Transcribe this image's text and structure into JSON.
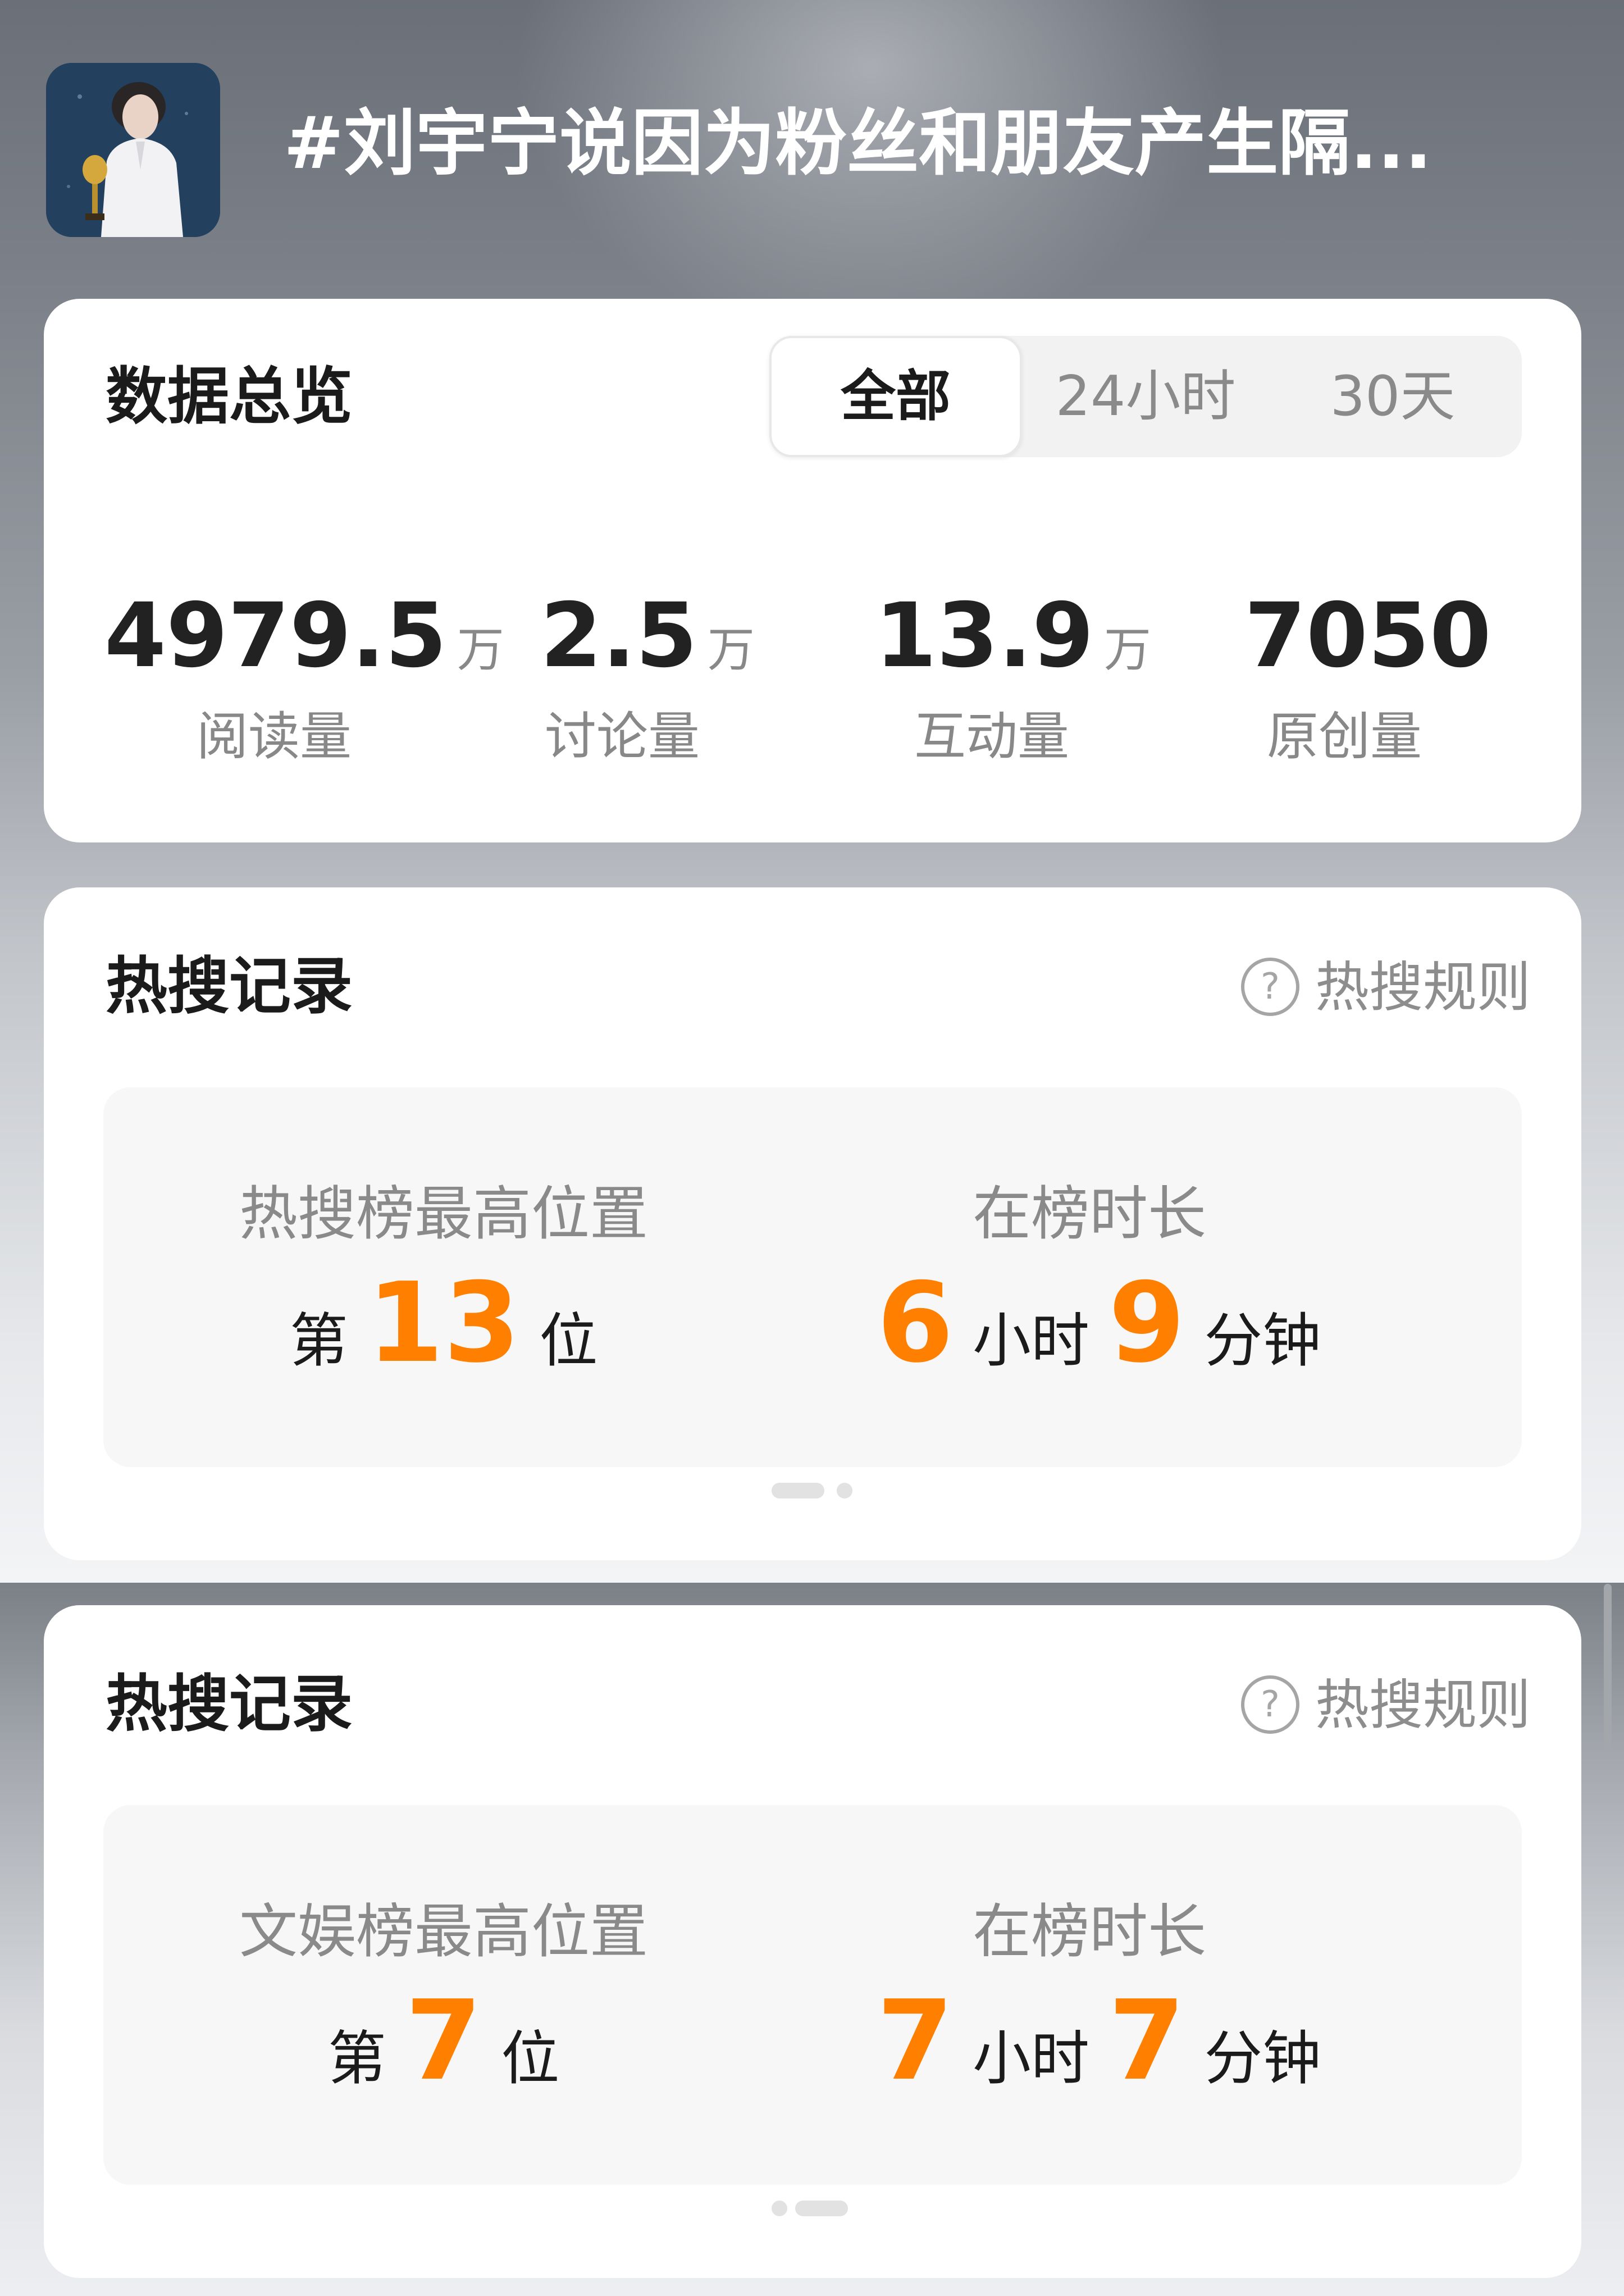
{
  "topic": {
    "title": "#刘宇宁说因为粉丝和朋友产生隔..."
  },
  "overview": {
    "title": "数据总览",
    "tabs": [
      {
        "label": "全部",
        "active": true
      },
      {
        "label": "24小时",
        "active": false
      },
      {
        "label": "30天",
        "active": false
      }
    ],
    "stats": [
      {
        "value": "4979.5",
        "unit": "万",
        "label": "阅读量"
      },
      {
        "value": "2.5",
        "unit": "万",
        "label": "讨论量"
      },
      {
        "value": "13.9",
        "unit": "万",
        "label": "互动量"
      },
      {
        "value": "7050",
        "unit": "",
        "label": "原创量"
      }
    ]
  },
  "hot_cards": [
    {
      "title": "热搜记录",
      "rules_label": "热搜规则",
      "rank_label": "热搜榜最高位置",
      "rank_prefix": "第",
      "rank_value": "13",
      "rank_suffix": "位",
      "duration_label": "在榜时长",
      "hours": "6",
      "hours_unit": "小时",
      "minutes": "9",
      "minutes_unit": "分钟",
      "active_page": 1,
      "total_pages": 2
    },
    {
      "title": "热搜记录",
      "rules_label": "热搜规则",
      "rank_label": "文娱榜最高位置",
      "rank_prefix": "第",
      "rank_value": "7",
      "rank_suffix": "位",
      "duration_label": "在榜时长",
      "hours": "7",
      "hours_unit": "小时",
      "minutes": "7",
      "minutes_unit": "分钟",
      "active_page": 2,
      "total_pages": 2
    }
  ],
  "colors": {
    "accent": "#ff7f00",
    "card_bg": "#ffffff",
    "inner_bg": "#f7f7f7",
    "muted_text": "#8a8a8a"
  }
}
